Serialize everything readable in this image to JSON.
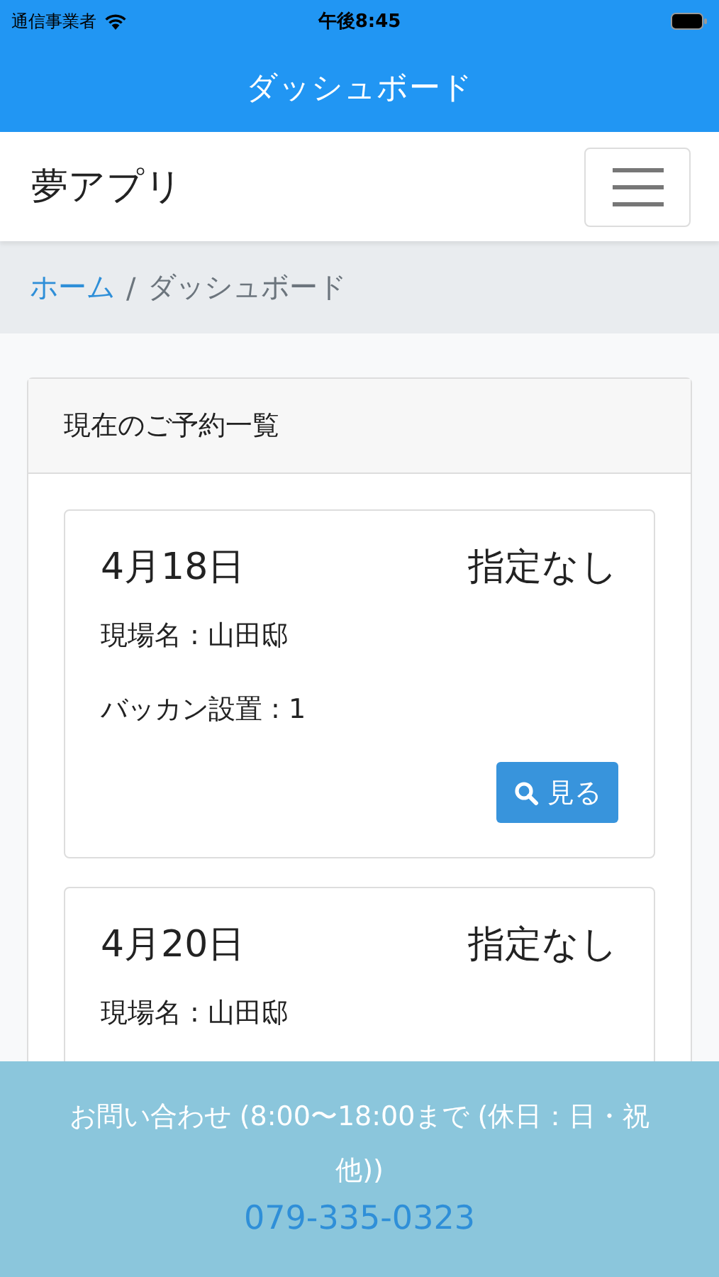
{
  "status_bar": {
    "carrier": "通信事業者",
    "time": "午後8:45"
  },
  "header": {
    "title": "ダッシュボード"
  },
  "navbar": {
    "brand": "夢アプリ"
  },
  "breadcrumb": {
    "separator": "/",
    "items": [
      {
        "label": "ホーム",
        "kind": "link"
      },
      {
        "label": "ダッシュボード",
        "kind": "current"
      }
    ]
  },
  "panel": {
    "title": "現在のご予約一覧",
    "reservations": [
      {
        "date": "4月18日",
        "status": "指定なし",
        "site": "現場名 : 山田邸",
        "count": "バッカン設置 : 1",
        "button": "見る"
      },
      {
        "date": "4月20日",
        "status": "指定なし",
        "site": "現場名 : 山田邸"
      }
    ]
  },
  "footer": {
    "text": "お問い合わせ (8:00〜18:00まで (休日：日・祝他))",
    "phone": "079-335-0323"
  }
}
